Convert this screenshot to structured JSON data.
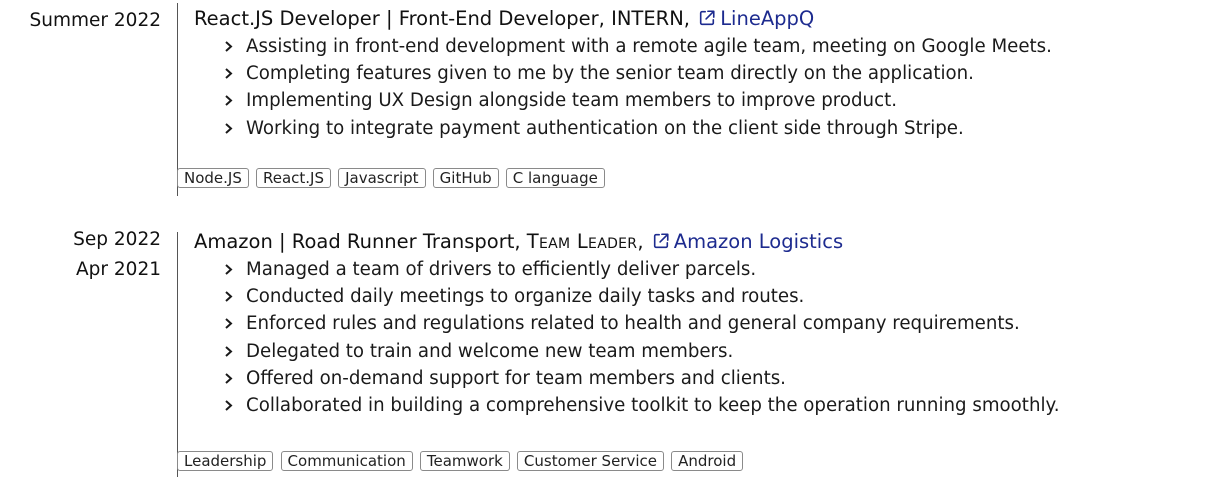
{
  "entries": [
    {
      "dates": [
        "Summer 2022"
      ],
      "title_main": "React.JS Developer | Front-End Developer, INTERN, ",
      "title_role_smallcaps": "",
      "link_text": "LineAppQ",
      "link_icon": "external-link-icon",
      "bullets": [
        "Assisting in front-end development with a remote agile team, meeting on Google Meets.",
        "Completing features given to me by the senior team directly on the application.",
        "Implementing UX Design alongside team members to improve product.",
        "Working to integrate payment authentication on the client side through Stripe."
      ],
      "tags": [
        "Node.JS",
        "React.JS",
        "Javascript",
        "GitHub",
        "C language"
      ]
    },
    {
      "dates": [
        "Sep 2022",
        "Apr 2021"
      ],
      "title_main": "Amazon | Road Runner Transport, ",
      "title_role_smallcaps": "Team Leader",
      "link_text": "Amazon Logistics",
      "link_icon": "external-link-icon",
      "bullets": [
        "Managed a team of drivers to efficiently deliver parcels.",
        "Conducted daily meetings to organize daily tasks and routes.",
        "Enforced rules and regulations related to health and general company requirements.",
        "Delegated to train and welcome new team members.",
        "Offered on-demand support for team members and clients.",
        "Collaborated in building a comprehensive toolkit to keep the operation running smoothly."
      ],
      "tags": [
        "Leadership",
        "Communication",
        "Teamwork",
        "Customer Service",
        "Android"
      ]
    }
  ],
  "colors": {
    "link": "#1d2b8f",
    "text": "#1a1a1a",
    "tag_border": "#8a8a8a"
  }
}
